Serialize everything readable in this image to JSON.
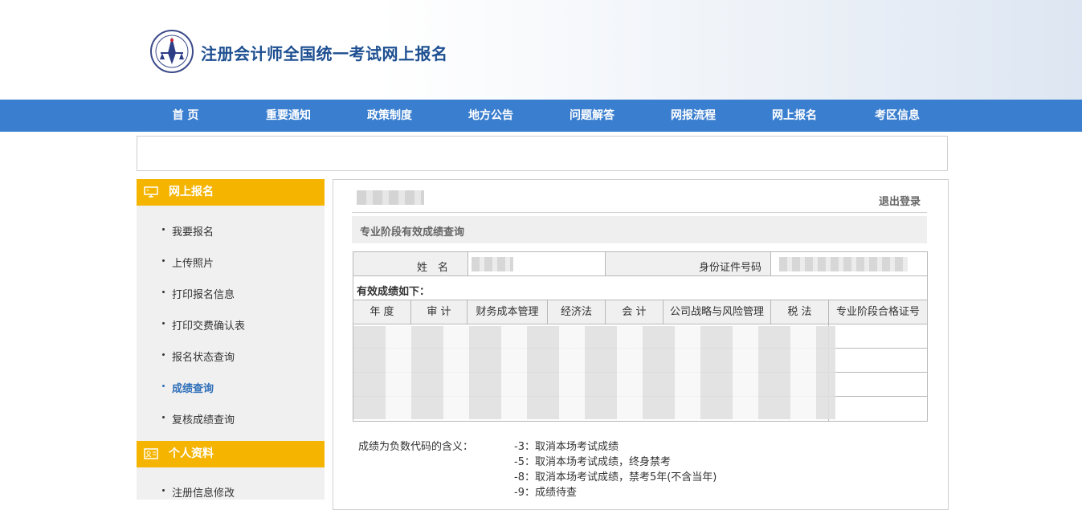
{
  "header": {
    "title": "注册会计师全国统一考试网上报名"
  },
  "nav": {
    "items": [
      "首 页",
      "重要通知",
      "政策制度",
      "地方公告",
      "问题解答",
      "网报流程",
      "网上报名",
      "考区信息"
    ]
  },
  "sidebar": {
    "sections": [
      {
        "title": "网上报名",
        "items": [
          "我要报名",
          "上传照片",
          "打印报名信息",
          "打印交费确认表",
          "报名状态查询",
          "成绩查询",
          "复核成绩查询"
        ]
      },
      {
        "title": "个人资料",
        "items": [
          "注册信息修改"
        ]
      }
    ],
    "active_item": "成绩查询"
  },
  "main": {
    "logout": "退出登录",
    "section_title": "专业阶段有效成绩查询",
    "name_label": "姓　名",
    "id_label": "身份证件号码",
    "valid_label": "有效成绩如下：",
    "columns": [
      "年 度",
      "审 计",
      "财务成本管理",
      "经济法",
      "会 计",
      "公司战略与风险管理",
      "税 法",
      "专业阶段合格证号"
    ],
    "notes_label": "成绩为负数代码的含义：",
    "notes": [
      "-3：取消本场考试成绩",
      "-5：取消本场考试成绩，终身禁考",
      "-8：取消本场考试成绩，禁考5年(不含当年)",
      "-9：成绩待查"
    ]
  },
  "colors": {
    "nav_bg": "#3a7ecf",
    "sidebar_head": "#f5b400",
    "active_link": "#2e6fb8",
    "title": "#1d4f91"
  }
}
